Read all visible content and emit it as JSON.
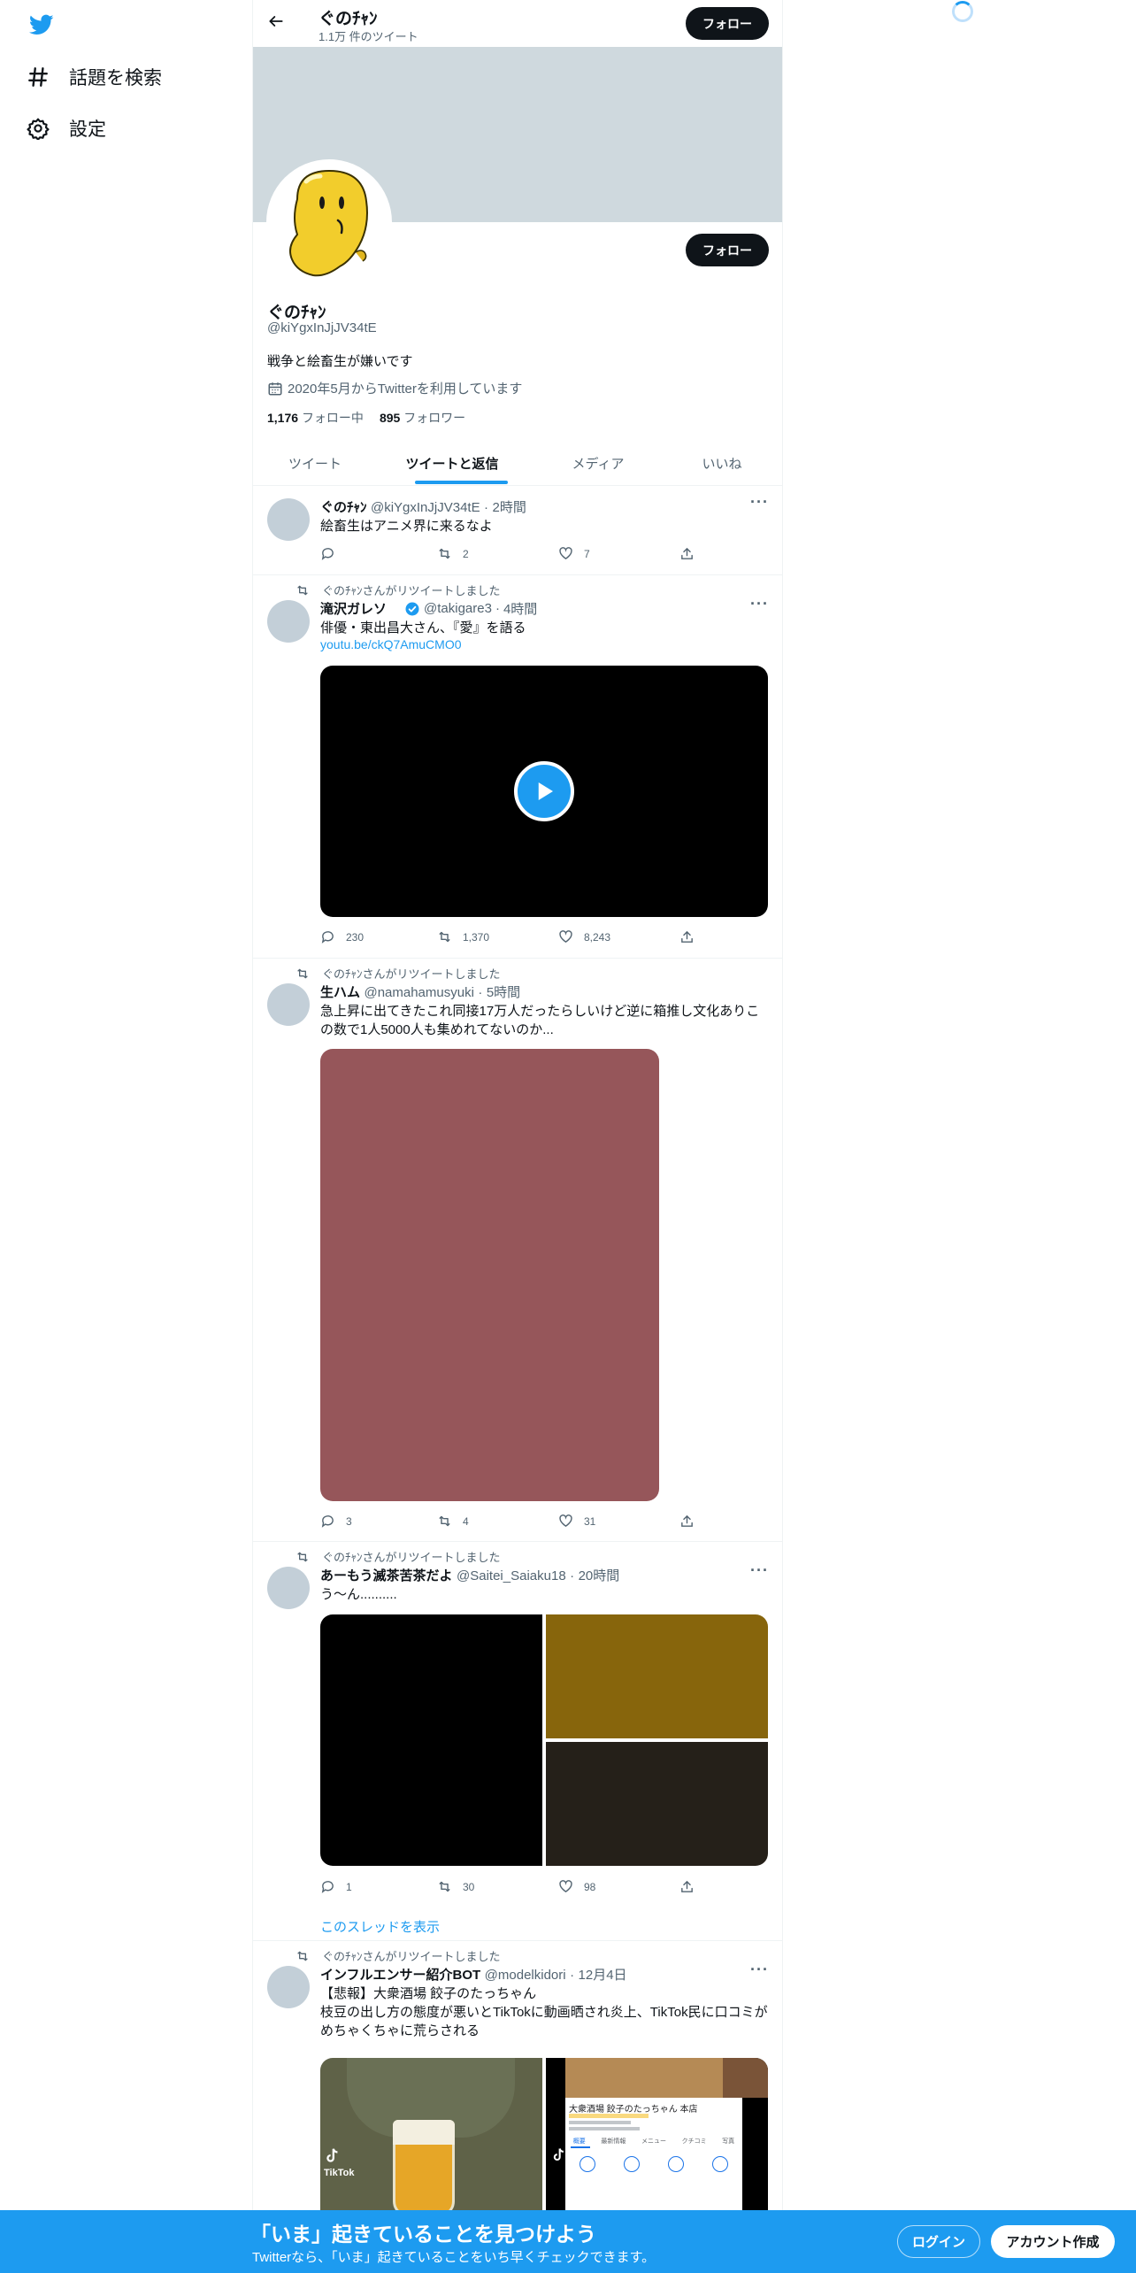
{
  "sidebar": {
    "logo_icon": "twitter-bird-icon",
    "items": [
      {
        "label": "話題を検索",
        "icon": "hashtag-icon"
      },
      {
        "label": "設定",
        "icon": "gear-icon"
      }
    ]
  },
  "header": {
    "name": "ぐのﾁｬﾝ",
    "tweet_count": "1.1万 件のツイート",
    "follow_label": "フォロー"
  },
  "profile": {
    "follow_label": "フォロー",
    "name": "ぐのﾁｬﾝ",
    "handle": "@kiYgxInJjJV34tE",
    "bio": "戦争と絵畜生が嫌いです",
    "joined": "2020年5月からTwitterを利用しています",
    "following_count": "1,176",
    "following_label": "フォロー中",
    "followers_count": "895",
    "followers_label": "フォロワー"
  },
  "tabs": [
    "ツイート",
    "ツイートと返信",
    "メディア",
    "いいね"
  ],
  "tweets": [
    {
      "name": "ぐのﾁｬﾝ",
      "handle": "@kiYgxInJjJV34tE",
      "time": "2時間",
      "text": "絵畜生はアニメ界に来るなよ",
      "replies": "",
      "retweets": "2",
      "likes": "7"
    },
    {
      "retweeted_by": "ぐのﾁｬﾝさんがリツイートしました",
      "name": "滝沢ガレソ",
      "handle": "@takigare3",
      "time": "4時間",
      "text": "俳優・東出昌大さん、『愛』を語る",
      "link": "youtu.be/ckQ7AmuCMO0",
      "replies": "230",
      "retweets": "1,370",
      "likes": "8,243"
    },
    {
      "retweeted_by": "ぐのﾁｬﾝさんがリツイートしました",
      "name": "生ハム",
      "handle": "@namahamusyuki",
      "time": "5時間",
      "text_line1": "急上昇に出てきたこれ同接17万人だったらしいけど逆に箱推し文化ありこ",
      "text_line2": "の数で1人5000人も集めれてないのか...",
      "replies": "3",
      "retweets": "4",
      "likes": "31",
      "image_color": "#96565a"
    },
    {
      "retweeted_by": "ぐのﾁｬﾝさんがリツイートしました",
      "name": "あーもう滅茶苦茶だよ",
      "handle": "@Saitei_Saiaku18",
      "time": "20時間",
      "text": "う～ん..........",
      "replies": "1",
      "retweets": "30",
      "likes": "98",
      "show_thread": "このスレッドを表示",
      "image_colors": [
        "#000000",
        "#87650c",
        "#252019"
      ]
    },
    {
      "retweeted_by": "ぐのﾁｬﾝさんがリツイートしました",
      "name": "インフルエンサー紹介BOT",
      "handle": "@modelkidori",
      "time": "12月4日",
      "text_line1": "【悲報】大衆酒場 餃子のたっちゃん",
      "text_line2": "枝豆の出し方の態度が悪いとTikTokに動画晒され炎上、TikTok民に口コミが",
      "text_line3": "めちゃくちゃに荒らされる",
      "card_title": "大衆酒場 餃子のたっちゃん 本店",
      "card_tabs": [
        "概要",
        "最新情報",
        "メニュー",
        "クチコミ",
        "写真"
      ],
      "tiktok_label": "TikTok"
    }
  ],
  "bottom_bar": {
    "title": "「いま」起きていることを見つけよう",
    "subtitle": "Twitterなら、「いま」起きていることをいち早くチェックできます。",
    "login_label": "ログイン",
    "signup_label": "アカウント作成"
  },
  "colors": {
    "accent": "#1d9bf0",
    "banner": "#cfd9de",
    "avatar_placeholder": "#c3cfd8"
  }
}
